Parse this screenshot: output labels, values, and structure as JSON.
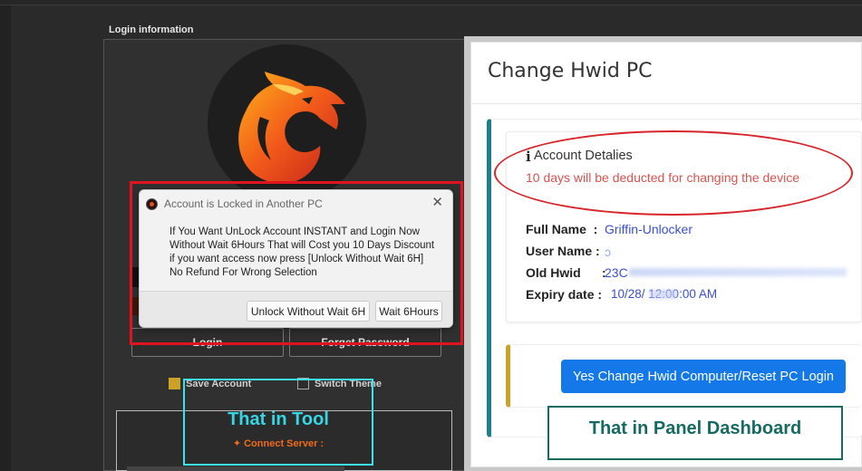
{
  "tool": {
    "login_info_label": "Login information",
    "login_button": "Login",
    "forgot_button": "Forget Password",
    "save_account_label": "Save Account",
    "save_account_checked": true,
    "switch_theme_label": "Switch Theme",
    "switch_theme_checked": false,
    "connect_server": "✦ Connect Server :",
    "logo_icon": "dragon-logo-icon"
  },
  "dialog": {
    "title": "Account is Locked in Another PC",
    "close_icon": "✕",
    "message_lines": [
      "If You Want UnLock Account INSTANT and Login Now",
      "Without Wait 6Hours That will Cost you 10 Days Discount",
      "if you want access now press [Unlock Without Wait 6H]",
      "No Refund For Wrong Selection"
    ],
    "unlock_button": "Unlock Without Wait 6H",
    "wait_button": "Wait 6Hours"
  },
  "annotations": {
    "tool": "That in Tool",
    "panel": "That in Panel Dashboard",
    "red_box_color": "#e0141e",
    "cyan_box_color": "#3fe1f0",
    "teal_box_color": "#156b62"
  },
  "panel": {
    "title": "Change Hwid PC",
    "info_icon": "i",
    "details_heading": "Account Detalies",
    "deduction_warning": "10 days will be deducted for changing the device",
    "fields": {
      "full_name_label": "Full Name",
      "full_name_value": "Griffin-Unlocker",
      "user_name_label": "User Name :",
      "user_name_value": "ɔ",
      "old_hwid_label": "Old Hwid",
      "old_hwid_value": "23C",
      "expiry_label": "Expiry date :",
      "expiry_value": "10/28/       12:00:00 AM"
    },
    "change_button": "Yes Change Hwid Computer/Reset PC Login",
    "accent_color": "#1478e8"
  }
}
